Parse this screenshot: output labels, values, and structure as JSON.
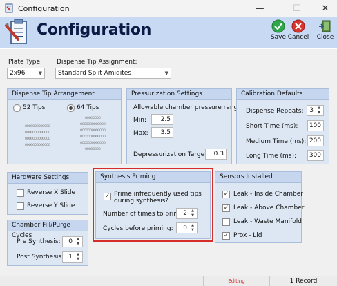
{
  "window": {
    "title": "Configuration",
    "minimize": "—",
    "maximize": "☐",
    "close": "✕"
  },
  "header": {
    "title": "Configuration",
    "save_label": "Save",
    "cancel_label": "Cancel",
    "close_label": "Close"
  },
  "plate_type": {
    "label": "Plate Type:",
    "value": "2x96"
  },
  "dispense_tip_assignment": {
    "label": "Dispense Tip Assignment:",
    "value": "Standard Split Amidites"
  },
  "dispense_tip_arrangement": {
    "title": "Dispense Tip Arrangement",
    "option_52": "52 Tips",
    "option_64": "64 Tips",
    "selected": "64 Tips",
    "pattern_52": "ooooooooooooo\nooooooooooooo\nooooooooooooo\nooooooooooooo",
    "pattern_64": "oooooooo\nooooooooooooo\nooooooooooooo\nooooooooooooo\nooooooooooooo\noooooooo"
  },
  "pressurization": {
    "title": "Pressurization Settings",
    "allowable_label": "Allowable chamber pressure range",
    "min_label": "Min:",
    "min_value": "2.5",
    "max_label": "Max:",
    "max_value": "3.5",
    "depress_label": "Depressurization Target:",
    "depress_value": "0.3"
  },
  "calibration": {
    "title": "Calibration Defaults",
    "dispense_repeats_label": "Dispense Repeats:",
    "dispense_repeats_value": "3",
    "short_time_label": "Short Time (ms):",
    "short_time_value": "100",
    "medium_time_label": "Medium Time (ms):",
    "medium_time_value": "200",
    "long_time_label": "Long Time (ms):",
    "long_time_value": "300"
  },
  "hardware": {
    "title": "Hardware Settings",
    "reverse_x": "Reverse X Slide",
    "reverse_y": "Reverse Y Slide"
  },
  "synthesis_priming": {
    "title": "Synthesis Priming",
    "prime_label": "Prime infrequently used tips during synthesis?",
    "times_label": "Number of times to prime:",
    "times_value": "2",
    "cycles_label": "Cycles before priming:",
    "cycles_value": "0"
  },
  "sensors": {
    "title": "Sensors Installed",
    "items": [
      {
        "label": "Leak - Inside Chamber",
        "checked": true,
        "mark": "✓"
      },
      {
        "label": "Leak - Above Chamber",
        "checked": true,
        "mark": "✓"
      },
      {
        "label": "Leak - Waste Manifold",
        "checked": false,
        "mark": ""
      },
      {
        "label": "Prox - Lid",
        "checked": true,
        "mark": "✓"
      }
    ]
  },
  "chamber_fill": {
    "title": "Chamber Fill/Purge Cycles",
    "pre_label": "Pre Synthesis:",
    "pre_value": "0",
    "post_label": "Post Synthesis:",
    "post_value": "1"
  },
  "status": {
    "state": "Editing",
    "record": "1 Record"
  },
  "colors": {
    "accent_red": "#d62c2c",
    "header_bg": "#c8daf3",
    "group_bg": "#dde7f4",
    "save_green": "#2fa84a",
    "cancel_red": "#d9342b"
  }
}
